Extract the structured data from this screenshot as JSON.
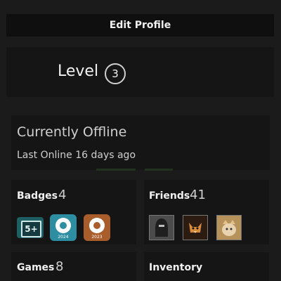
{
  "top": {
    "edit_profile_label": "Edit Profile"
  },
  "level": {
    "label": "Level",
    "value": "3"
  },
  "status": {
    "title": "Currently Offline",
    "subtitle": "Last Online 16 days ago"
  },
  "badges": {
    "label": "Badges",
    "count": "4",
    "items": [
      {
        "name": "5+ years badge",
        "text": "5+",
        "color": "#1d5f63"
      },
      {
        "name": "Steam 2024 badge",
        "year": "2024",
        "color": "#2c8ea0"
      },
      {
        "name": "Steam 2023 badge",
        "year": "2023",
        "color": "#a95d2b"
      }
    ]
  },
  "friends": {
    "label": "Friends",
    "count": "41",
    "avatars": [
      {
        "name": "friend-avatar-1",
        "color": "#5b5b5b"
      },
      {
        "name": "friend-avatar-2",
        "color": "#3d2a17"
      },
      {
        "name": "friend-avatar-3",
        "color": "#c2a06b"
      }
    ]
  },
  "games": {
    "label": "Games",
    "count": "8"
  },
  "inventory": {
    "label": "Inventory"
  }
}
